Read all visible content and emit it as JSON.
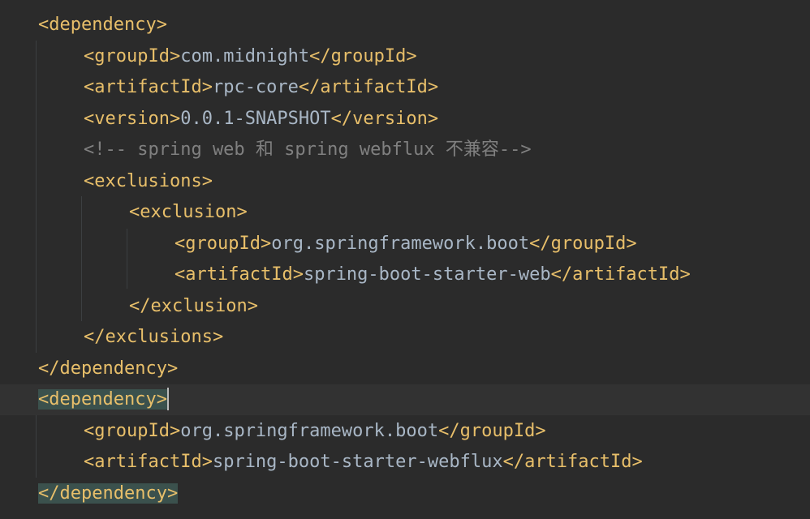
{
  "colors": {
    "background": "#2b2b2b",
    "tag": "#e8bf6a",
    "text": "#a9b7c6",
    "comment": "#808080",
    "current_line": "#323232",
    "tag_match_highlight": "#3b514d"
  },
  "lines": [
    {
      "indent": 0,
      "open": "<dependency>",
      "text": "",
      "close": ""
    },
    {
      "indent": 1,
      "open": "<groupId>",
      "text": "com.midnight",
      "close": "</groupId>"
    },
    {
      "indent": 1,
      "open": "<artifactId>",
      "text": "rpc-core",
      "close": "</artifactId>"
    },
    {
      "indent": 1,
      "open": "<version>",
      "text": "0.0.1-SNAPSHOT",
      "close": "</version>"
    },
    {
      "indent": 1,
      "comment": "<!-- spring web 和 spring webflux 不兼容-->"
    },
    {
      "indent": 1,
      "open": "<exclusions>",
      "text": "",
      "close": ""
    },
    {
      "indent": 2,
      "open": "<exclusion>",
      "text": "",
      "close": ""
    },
    {
      "indent": 3,
      "open": "<groupId>",
      "text": "org.springframework.boot",
      "close": "</groupId>"
    },
    {
      "indent": 3,
      "open": "<artifactId>",
      "text": "spring-boot-starter-web",
      "close": "</artifactId>"
    },
    {
      "indent": 2,
      "open": "</exclusion>",
      "text": "",
      "close": ""
    },
    {
      "indent": 1,
      "open": "</exclusions>",
      "text": "",
      "close": ""
    },
    {
      "indent": 0,
      "open": "</dependency>",
      "text": "",
      "close": ""
    },
    {
      "indent": 0,
      "open": "<dependency>",
      "text": "",
      "close": "",
      "current": true,
      "match": true,
      "caret": true
    },
    {
      "indent": 1,
      "open": "<groupId>",
      "text": "org.springframework.boot",
      "close": "</groupId>"
    },
    {
      "indent": 1,
      "open": "<artifactId>",
      "text": "spring-boot-starter-webflux",
      "close": "</artifactId>"
    },
    {
      "indent": 0,
      "open": "</dependency>",
      "text": "",
      "close": "",
      "match": true
    }
  ]
}
